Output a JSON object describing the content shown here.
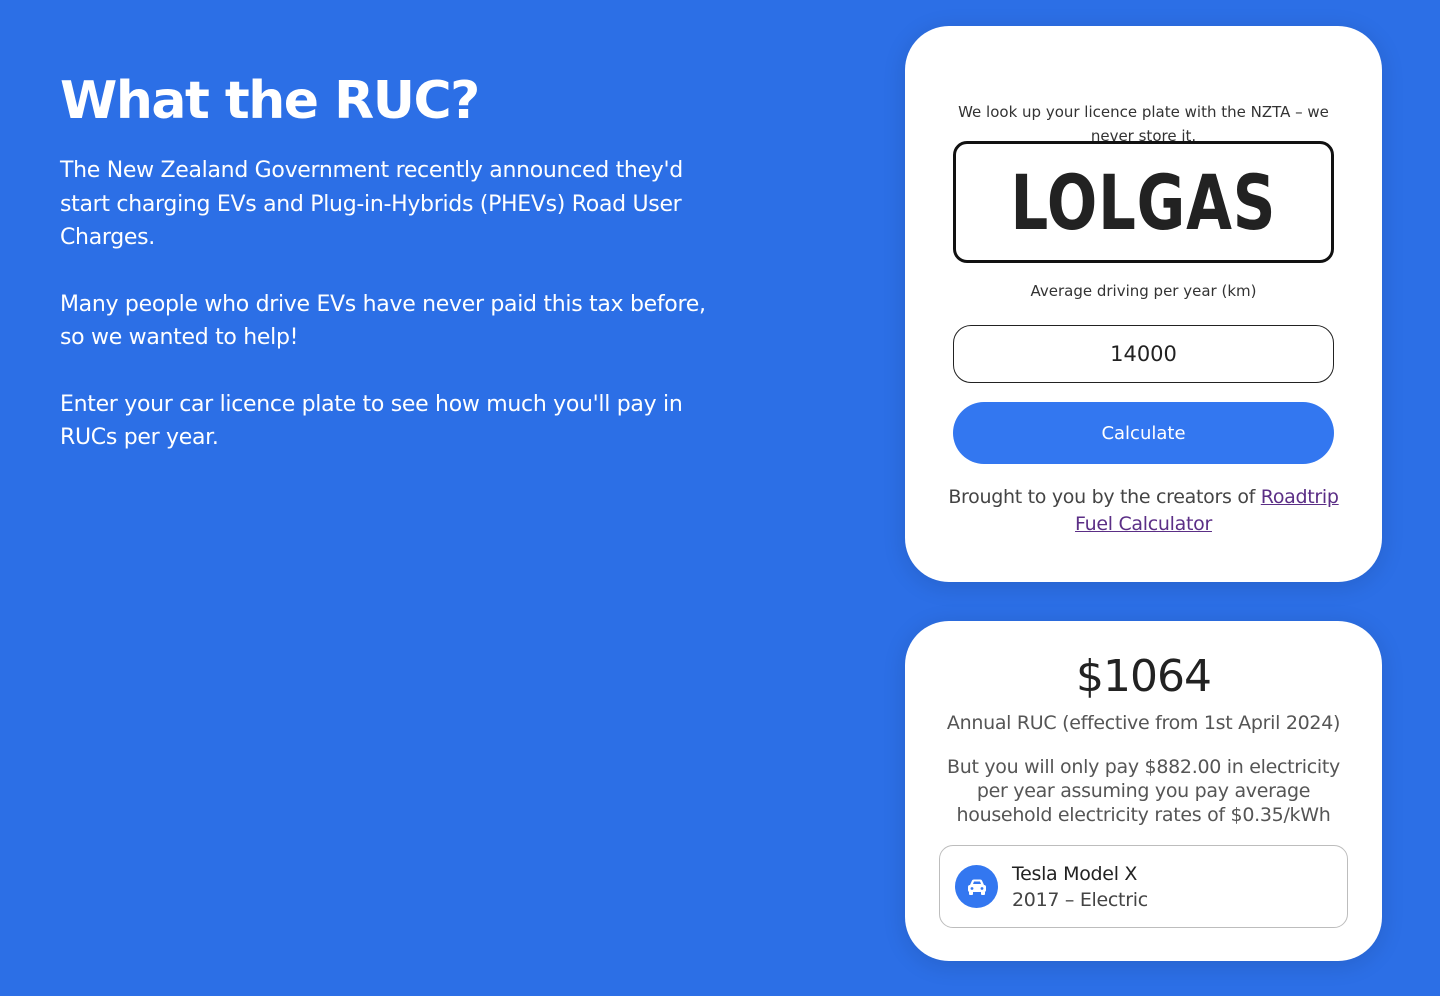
{
  "intro": {
    "title": "What the RUC?",
    "paragraphs": [
      "The New Zealand Government recently announced they'd start charging EVs and Plug-in-Hybrids (PHEVs) Road User Charges.",
      "Many people who drive EVs have never paid this tax before, so we wanted to help!",
      "Enter your car licence plate to see how much you'll pay in RUCs per year."
    ]
  },
  "form": {
    "lookup_note": "We look up your licence plate with the NZTA – we never store it.",
    "plate": "LOLGAS",
    "driving_label": "Average driving per year (km)",
    "driving_value": "14000",
    "calculate_label": "Calculate",
    "credit_prefix": "Brought to you by the creators of ",
    "credit_link": "Roadtrip Fuel Calculator"
  },
  "result": {
    "amount": "$1064",
    "annual_label": "Annual RUC (effective from 1st April 2024)",
    "electricity_note": "But you will only pay $882.00 in electricity per year assuming you pay average household electricity rates of $0.35/kWh",
    "vehicle": {
      "icon": "car-icon",
      "name": "Tesla Model X",
      "meta": "2017 – Electric"
    }
  },
  "colors": {
    "background": "#2c6fe6",
    "accent": "#3377f0",
    "link": "#5b2e86"
  }
}
